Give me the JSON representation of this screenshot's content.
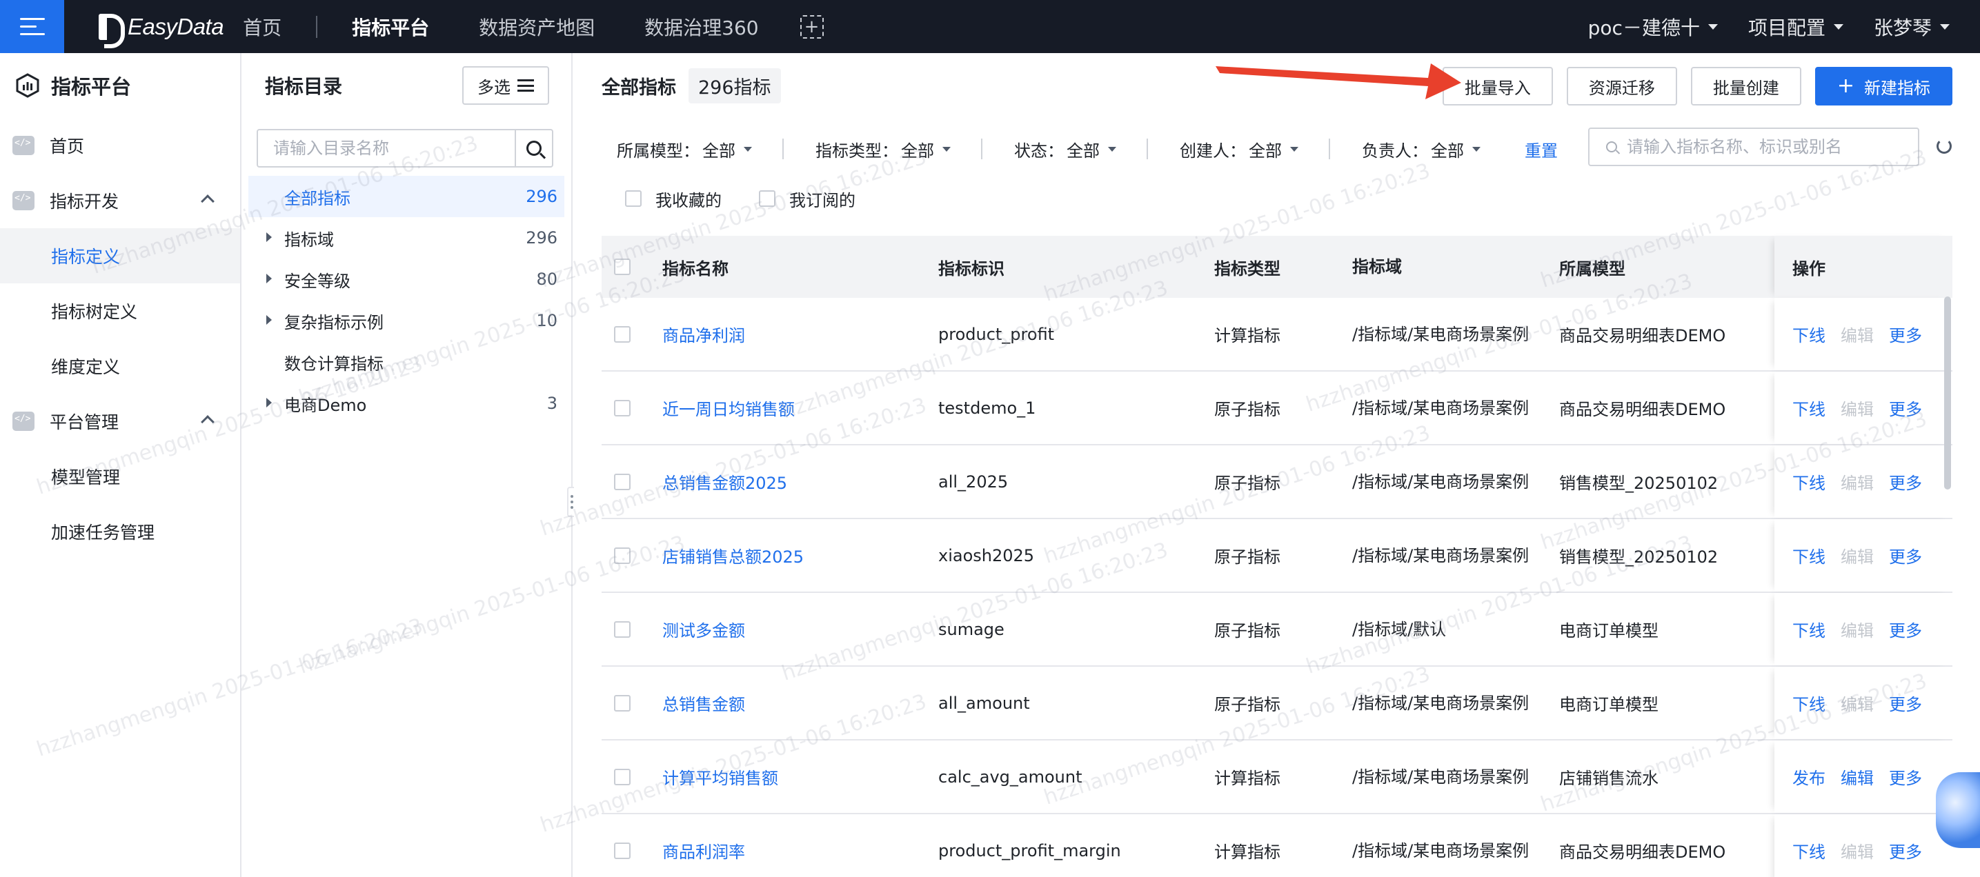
{
  "topbar": {
    "brand": "EasyData",
    "nav": [
      "首页",
      "指标平台",
      "数据资产地图",
      "数据治理360"
    ],
    "active_index": 1,
    "project": "poc－建德十",
    "project_config": "项目配置",
    "user": "张梦琴"
  },
  "sidebar": {
    "title": "指标平台",
    "items": [
      {
        "label": "首页",
        "type": "top"
      },
      {
        "label": "指标开发",
        "type": "group"
      },
      {
        "label": "指标定义",
        "type": "sub",
        "active": true
      },
      {
        "label": "指标树定义",
        "type": "sub"
      },
      {
        "label": "维度定义",
        "type": "sub"
      },
      {
        "label": "平台管理",
        "type": "group"
      },
      {
        "label": "模型管理",
        "type": "sub"
      },
      {
        "label": "加速任务管理",
        "type": "sub"
      }
    ]
  },
  "directory": {
    "title": "指标目录",
    "multi_select": "多选",
    "search_placeholder": "请输入目录名称",
    "tree": [
      {
        "label": "全部指标",
        "count": "296",
        "active": true,
        "expandable": false
      },
      {
        "label": "指标域",
        "count": "296",
        "expandable": true
      },
      {
        "label": "安全等级",
        "count": "80",
        "expandable": true
      },
      {
        "label": "复杂指标示例",
        "count": "10",
        "expandable": true
      },
      {
        "label": "数仓计算指标",
        "count": "",
        "expandable": false
      },
      {
        "label": "电商Demo",
        "count": "3",
        "expandable": true
      }
    ]
  },
  "main": {
    "title": "全部指标",
    "count": "296指标",
    "buttons": {
      "batch_import": "批量导入",
      "migrate": "资源迁移",
      "batch_create": "批量创建",
      "create": "新建指标"
    },
    "filters": [
      {
        "label": "所属模型：",
        "value": "全部"
      },
      {
        "label": "指标类型：",
        "value": "全部"
      },
      {
        "label": "状态：",
        "value": "全部"
      },
      {
        "label": "创建人：",
        "value": "全部"
      },
      {
        "label": "负责人：",
        "value": "全部"
      }
    ],
    "reset": "重置",
    "search_placeholder": "请输入指标名称、标识或别名",
    "checks": [
      "我收藏的",
      "我订阅的"
    ],
    "columns": [
      "指标名称",
      "指标标识",
      "指标类型",
      "指标域",
      "所属模型",
      "操作"
    ],
    "rows": [
      {
        "name": "商品净利润",
        "id": "product_profit",
        "type": "计算指标",
        "domain": "/指标域/某电商场景案例",
        "model": "商品交易明细表DEMO",
        "ops": [
          "下线",
          "编辑",
          "更多"
        ],
        "editable": false
      },
      {
        "name": "近一周日均销售额",
        "id": "testdemo_1",
        "type": "原子指标",
        "domain": "/指标域/某电商场景案例",
        "model": "商品交易明细表DEMO",
        "ops": [
          "下线",
          "编辑",
          "更多"
        ],
        "editable": false
      },
      {
        "name": "总销售金额2025",
        "id": "all_2025",
        "type": "原子指标",
        "domain": "/指标域/某电商场景案例",
        "model": "销售模型_20250102",
        "ops": [
          "下线",
          "编辑",
          "更多"
        ],
        "editable": false
      },
      {
        "name": "店铺销售总额2025",
        "id": "xiaosh2025",
        "type": "原子指标",
        "domain": "/指标域/某电商场景案例",
        "model": "销售模型_20250102",
        "ops": [
          "下线",
          "编辑",
          "更多"
        ],
        "editable": false
      },
      {
        "name": "测试多金额",
        "id": "sumage",
        "type": "原子指标",
        "domain": "/指标域/默认",
        "model": "电商订单模型",
        "ops": [
          "下线",
          "编辑",
          "更多"
        ],
        "editable": false
      },
      {
        "name": "总销售金额",
        "id": "all_amount",
        "type": "原子指标",
        "domain": "/指标域/某电商场景案例",
        "model": "电商订单模型",
        "ops": [
          "下线",
          "编辑",
          "更多"
        ],
        "editable": false
      },
      {
        "name": "计算平均销售额",
        "id": "calc_avg_amount",
        "type": "计算指标",
        "domain": "/指标域/某电商场景案例",
        "model": "店铺销售流水",
        "ops": [
          "发布",
          "编辑",
          "更多"
        ],
        "editable": true
      },
      {
        "name": "商品利润率",
        "id": "product_profit_margin",
        "type": "计算指标",
        "domain": "/指标域/某电商场景案例",
        "model": "商品交易明细表DEMO",
        "ops": [
          "下线",
          "编辑",
          "更多"
        ],
        "editable": false
      }
    ]
  },
  "watermark": "hzzhangmengqin 2025-01-06 16:20:23",
  "colors": {
    "accent": "#1f6feb",
    "topbar": "#161b26",
    "arrow": "#e8402c"
  }
}
